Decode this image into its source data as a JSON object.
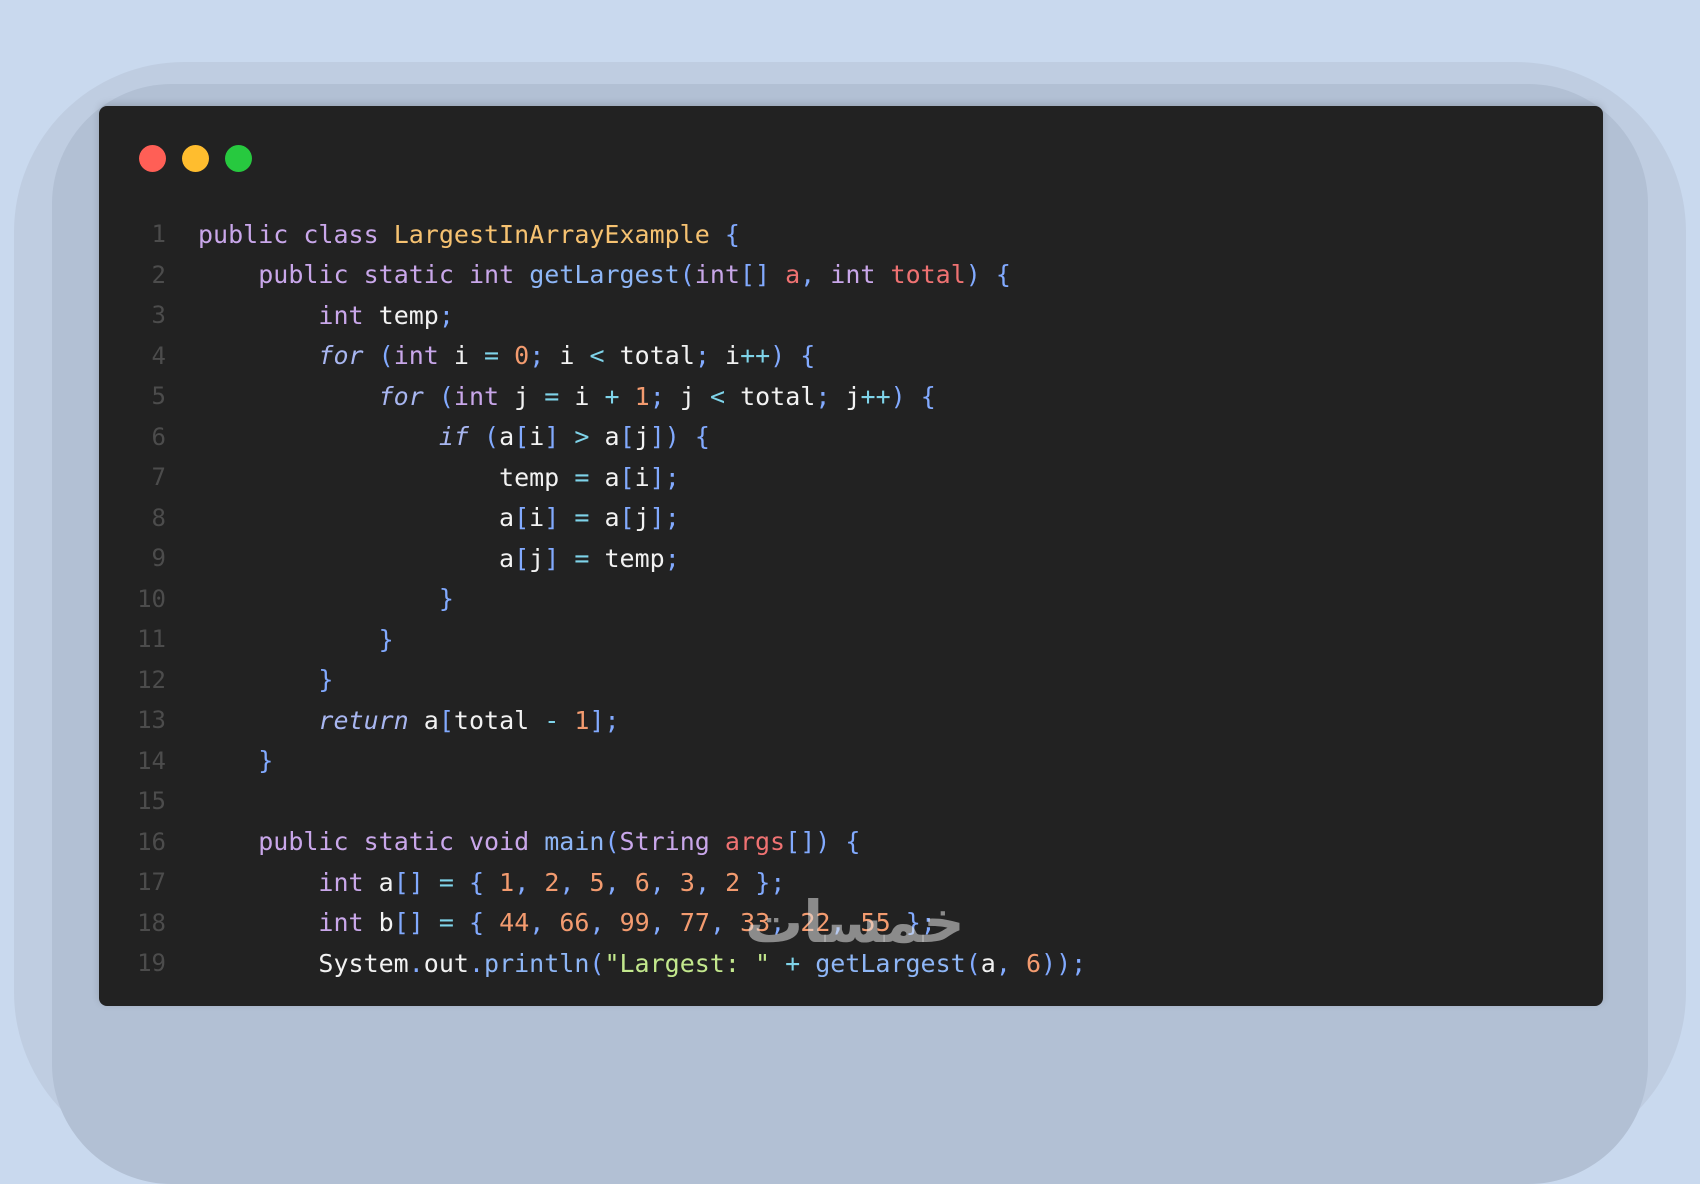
{
  "window": {
    "controls": [
      {
        "name": "close",
        "color": "#ff5f56"
      },
      {
        "name": "minimize",
        "color": "#ffbd2e"
      },
      {
        "name": "maximize",
        "color": "#27c93f"
      }
    ]
  },
  "code": {
    "language": "java",
    "lines": [
      {
        "number": "1",
        "text": "public class LargestInArrayExample {"
      },
      {
        "number": "2",
        "text": "    public static int getLargest(int[] a, int total) {"
      },
      {
        "number": "3",
        "text": "        int temp;"
      },
      {
        "number": "4",
        "text": "        for (int i = 0; i < total; i++) {"
      },
      {
        "number": "5",
        "text": "            for (int j = i + 1; j < total; j++) {"
      },
      {
        "number": "6",
        "text": "                if (a[i] > a[j]) {"
      },
      {
        "number": "7",
        "text": "                    temp = a[i];"
      },
      {
        "number": "8",
        "text": "                    a[i] = a[j];"
      },
      {
        "number": "9",
        "text": "                    a[j] = temp;"
      },
      {
        "number": "10",
        "text": "                }"
      },
      {
        "number": "11",
        "text": "            }"
      },
      {
        "number": "12",
        "text": "        }"
      },
      {
        "number": "13",
        "text": "        return a[total - 1];"
      },
      {
        "number": "14",
        "text": "    }"
      },
      {
        "number": "15",
        "text": ""
      },
      {
        "number": "16",
        "text": "    public static void main(String args[]) {"
      },
      {
        "number": "17",
        "text": "        int a[] = { 1, 2, 5, 6, 3, 2 };"
      },
      {
        "number": "18",
        "text": "        int b[] = { 44, 66, 99, 77, 33, 22, 55 };"
      },
      {
        "number": "19",
        "text": "        System.out.println(\"Largest: \" + getLargest(a, 6));"
      }
    ]
  },
  "watermark": {
    "text": "خمسات"
  }
}
